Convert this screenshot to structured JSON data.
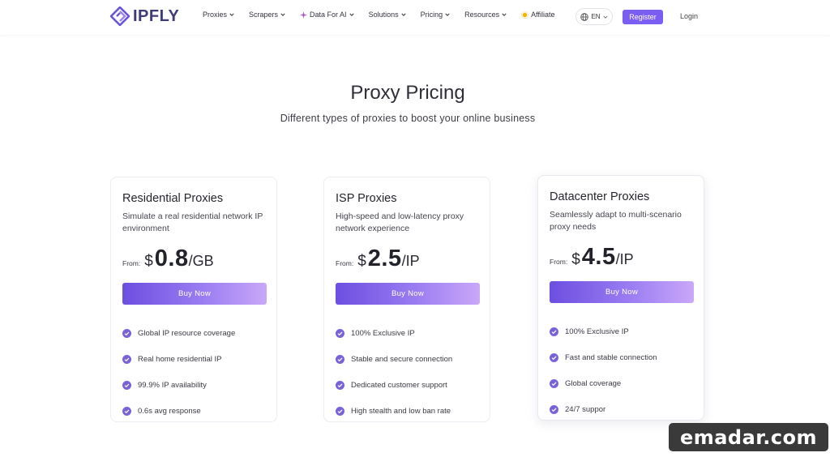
{
  "header": {
    "brand": "IPFLY",
    "nav": [
      {
        "label": "Proxies",
        "icon": ""
      },
      {
        "label": "Scrapers",
        "icon": ""
      },
      {
        "label": "Data For AI",
        "icon": "sparkle-icon"
      },
      {
        "label": "Solutions",
        "icon": ""
      },
      {
        "label": "Pricing",
        "icon": ""
      },
      {
        "label": "Resources",
        "icon": ""
      },
      {
        "label": "Affiliate",
        "icon": "sun-icon"
      }
    ],
    "language": "EN",
    "register_label": "Register",
    "login_label": "Login"
  },
  "hero": {
    "title": "Proxy Pricing",
    "subtitle": "Different types of proxies to boost your online business"
  },
  "cards": [
    {
      "title": "Residential Proxies",
      "desc": "Simulate a real residential network IP environment",
      "from": "From:",
      "currency": "$",
      "amount": "0.8",
      "unit": "/GB",
      "buy_label": "Buy Now",
      "features": [
        "Global IP resource coverage",
        "Real home residential IP",
        "99.9% IP availability",
        "0.6s avg response"
      ]
    },
    {
      "title": "ISP Proxies",
      "desc": "High-speed and low-latency proxy network experience",
      "from": "From:",
      "currency": "$",
      "amount": "2.5",
      "unit": "/IP",
      "buy_label": "Buy Now",
      "features": [
        "100% Exclusive IP",
        "Stable and secure connection",
        "Dedicated customer support",
        "High stealth and low ban rate"
      ]
    },
    {
      "title": "Datacenter Proxies",
      "desc": "Seamlessly adapt to multi-scenario proxy needs",
      "from": "From:",
      "currency": "$",
      "amount": "4.5",
      "unit": "/IP",
      "buy_label": "Buy Now",
      "features": [
        "100% Exclusive IP",
        "Fast and stable connection",
        "Global coverage",
        "24/7 suppor"
      ]
    }
  ],
  "watermark": "emadar.com",
  "colors": {
    "accent": "#7a5ef2",
    "check": "#7a63d9",
    "brand_text": "#3f3b78"
  }
}
